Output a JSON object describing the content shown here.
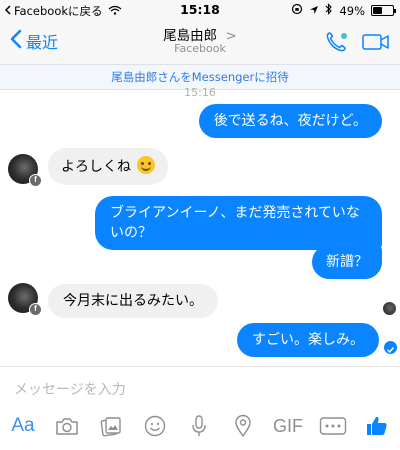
{
  "status_bar": {
    "back_app": "Facebookに戻る",
    "time": "15:18",
    "battery": "49%",
    "battery_level": 0.49
  },
  "nav": {
    "back_label": "最近",
    "title": "尾島由郎",
    "title_chevron": ">",
    "subtitle": "Facebook"
  },
  "invite_banner": "尾島由郎さんをMessengerに招待",
  "timestamp": "15:16",
  "messages": [
    {
      "side": "out",
      "text": "後で送るね、夜だけど。"
    },
    {
      "side": "in",
      "text": "よろしくね",
      "emoji": "smiling-face-emoji"
    },
    {
      "side": "out",
      "text": "ブライアンイーノ、まだ発売されていないの？"
    },
    {
      "side": "out",
      "text": "新譜？"
    },
    {
      "side": "in",
      "text": "今月末に出るみたい。"
    },
    {
      "side": "out",
      "text": "すごい。楽しみ。"
    }
  ],
  "composer": {
    "placeholder": "メッセージを入力",
    "tools": [
      {
        "name": "text-format-icon",
        "label": "Aa"
      },
      {
        "name": "camera-icon"
      },
      {
        "name": "photo-gallery-icon"
      },
      {
        "name": "sticker-icon"
      },
      {
        "name": "microphone-icon"
      },
      {
        "name": "location-icon"
      },
      {
        "name": "gif-icon",
        "label": "GIF"
      },
      {
        "name": "more-icon"
      },
      {
        "name": "like-icon"
      }
    ]
  },
  "colors": {
    "accent": "#0a84ff",
    "incoming_bubble": "#f1f0f0",
    "call_green": "#44bec7"
  }
}
